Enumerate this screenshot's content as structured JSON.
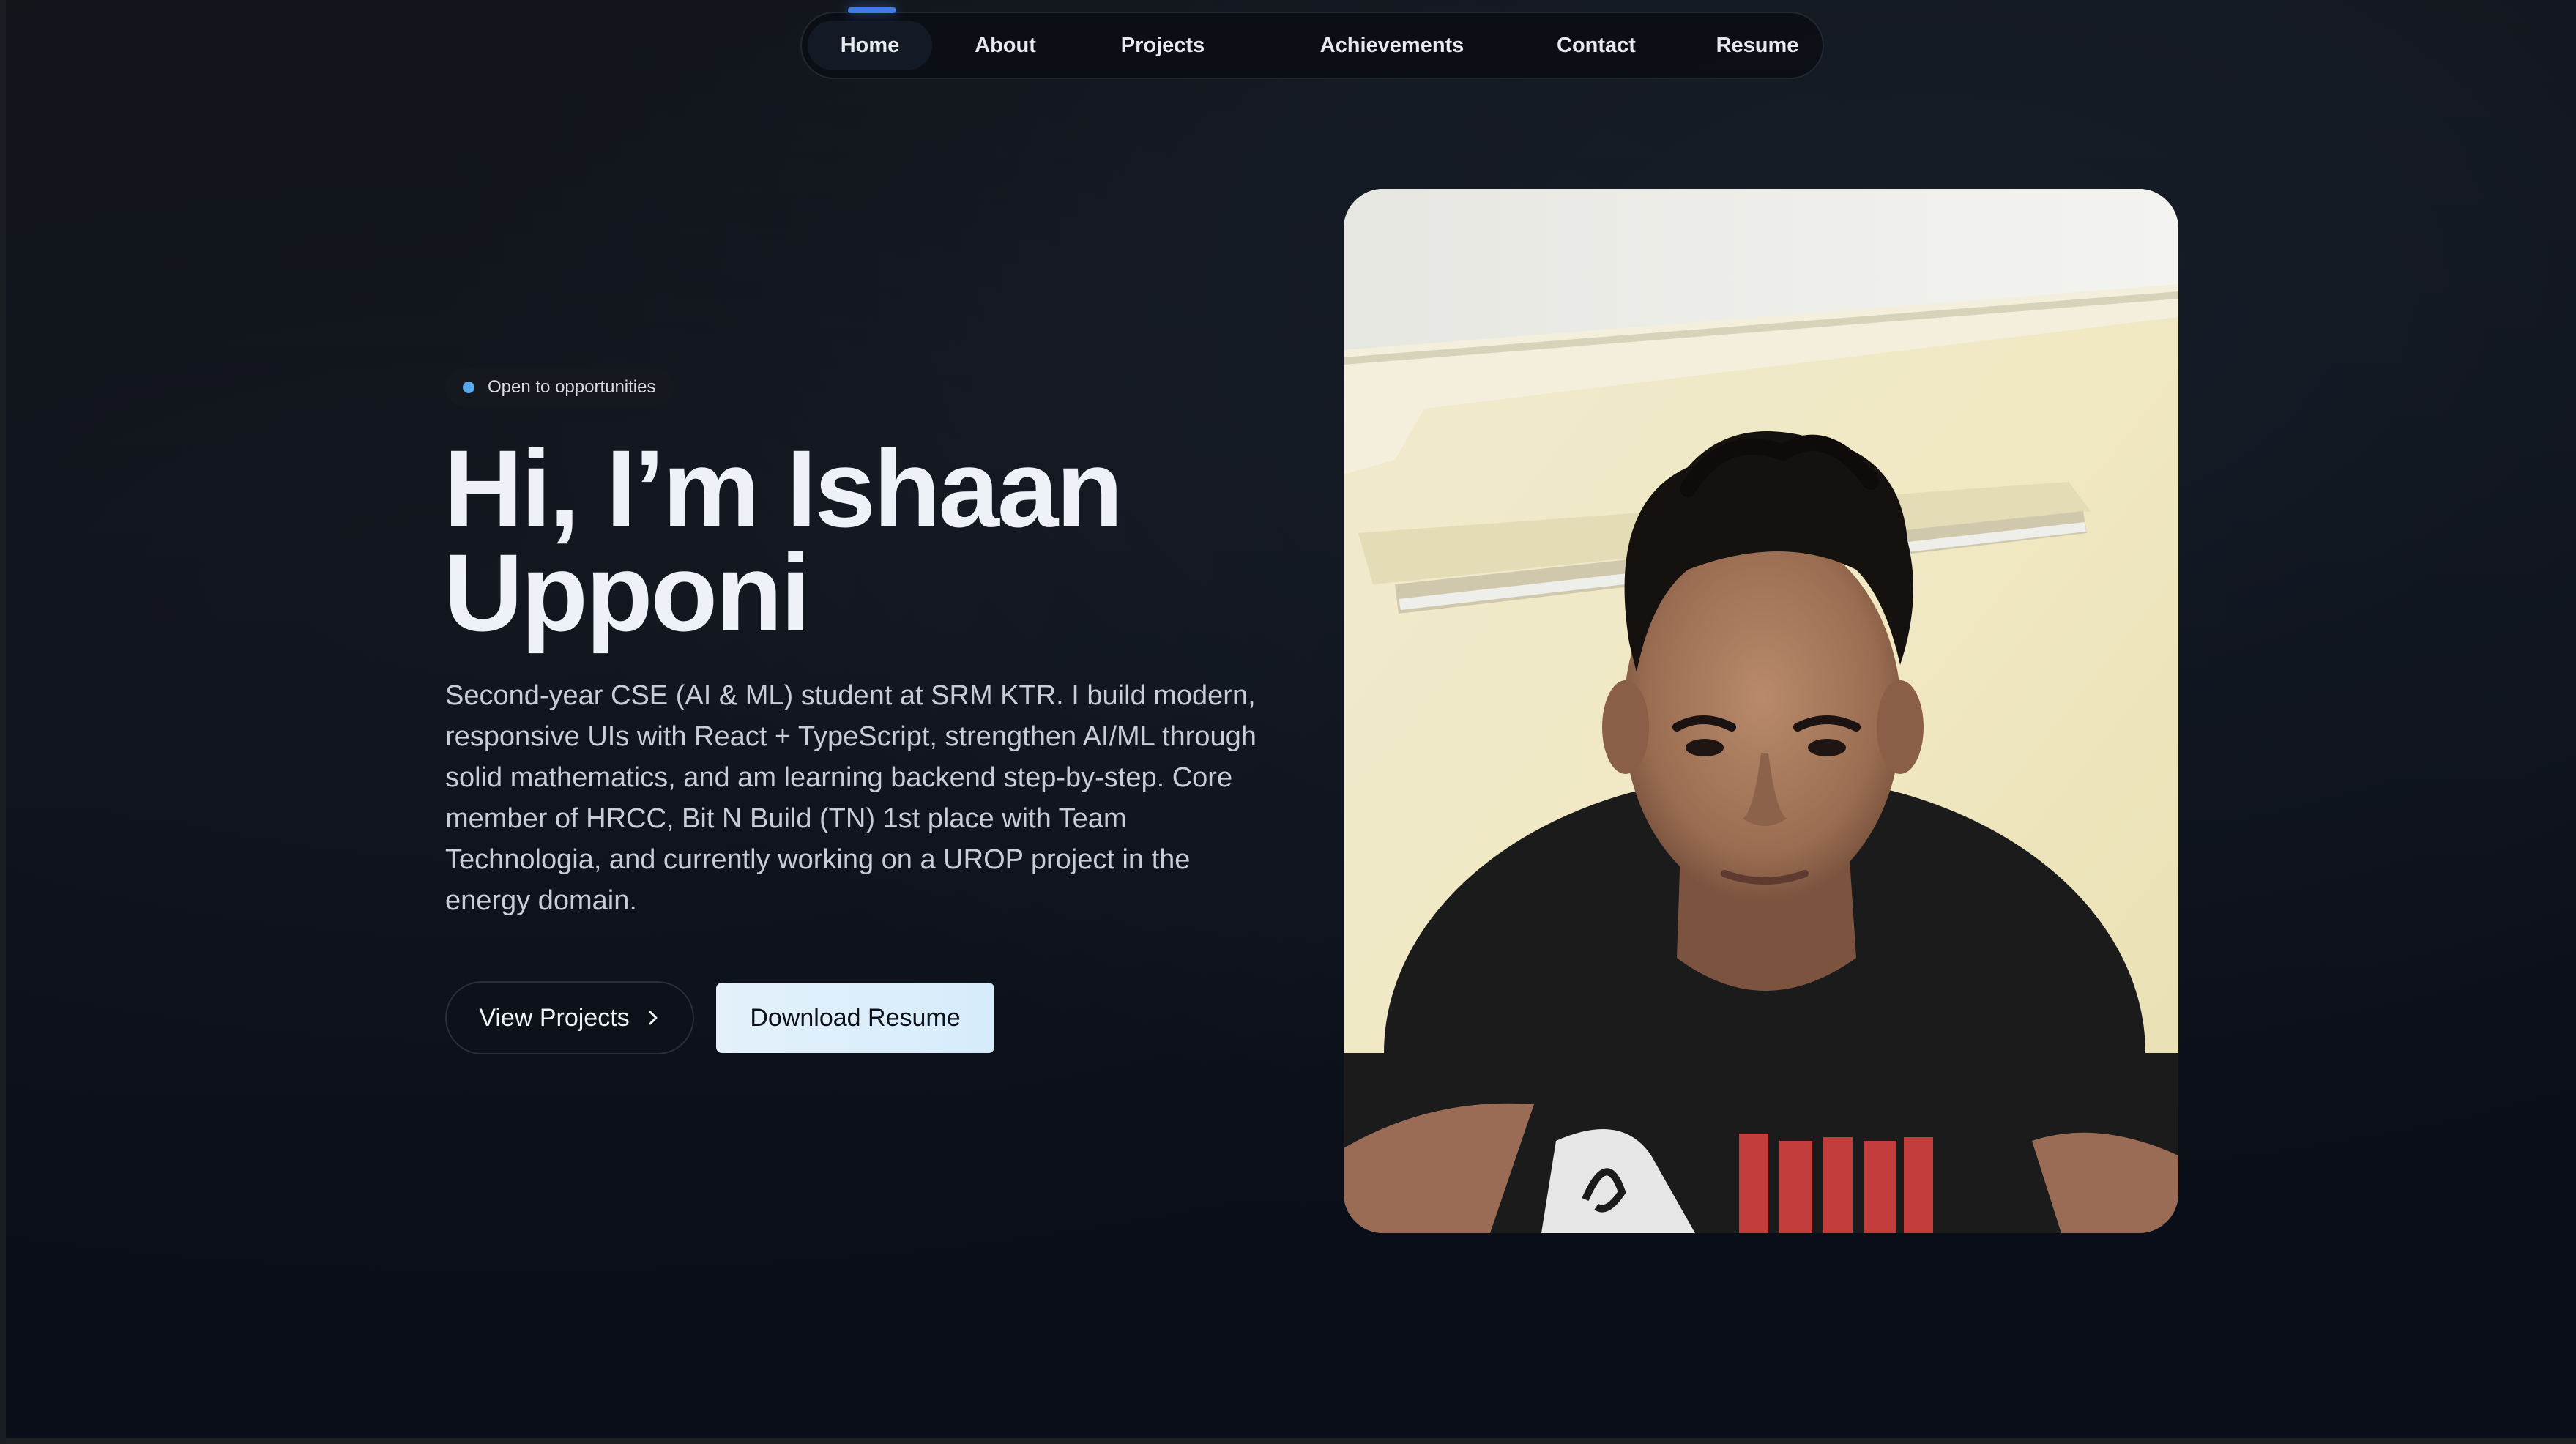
{
  "nav": {
    "items": [
      {
        "label": "Home",
        "active": true
      },
      {
        "label": "About",
        "active": false
      },
      {
        "label": "Projects",
        "active": false
      },
      {
        "label": "Achievements",
        "active": false
      },
      {
        "label": "Contact",
        "active": false
      },
      {
        "label": "Resume",
        "active": false
      }
    ]
  },
  "hero": {
    "status": "Open to opportunities",
    "title_line1": "Hi, I’m Ishaan",
    "title_line2": "Upponi",
    "description": "Second-year CSE (AI & ML) student at SRM KTR. I build modern, responsive UIs with React + TypeScript, strengthen AI/ML through solid mathematics, and am learning backend step-by-step. Core member of HRCC, Bit N Build (TN) 1st place with Team Technologia, and currently working on a UROP project in the energy domain.",
    "primary_button": "View Projects",
    "secondary_button": "Download Resume"
  },
  "icons": {
    "chevron": "chevron-right-icon",
    "status_dot": "status-dot"
  },
  "colors": {
    "background": "#0b0f17",
    "accent": "#3f7ee0",
    "status_dot": "#5aa9ef",
    "resume_button": "#dcedfb"
  }
}
